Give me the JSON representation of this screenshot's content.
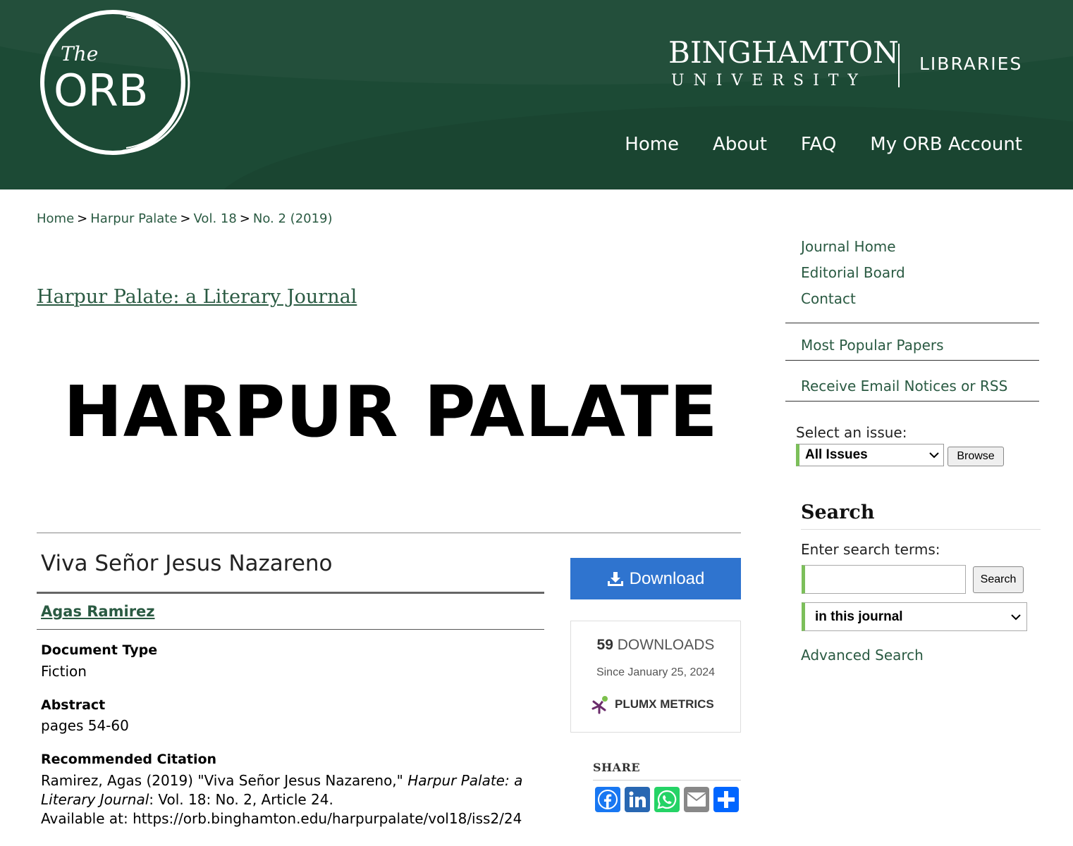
{
  "header": {
    "orb_logo_top": "The",
    "orb_logo_main": "ORB",
    "university_name": "BINGHAMTON",
    "university_sub": "UNIVERSITY",
    "libraries": "LIBRARIES",
    "nav": [
      "Home",
      "About",
      "FAQ",
      "My ORB Account"
    ],
    "background_color": "#1c4a35"
  },
  "breadcrumb": {
    "items": [
      "Home",
      "Harpur Palate",
      "Vol. 18",
      "No. 2 (2019)"
    ],
    "separator": ">"
  },
  "journal": {
    "title": "Harpur Palate: a Literary Journal",
    "banner": "HARPUR PALATE"
  },
  "article": {
    "title": "Viva Señor Jesus Nazareno",
    "author": "Agas Ramirez",
    "document_type_label": "Document Type",
    "document_type": "Fiction",
    "abstract_label": "Abstract",
    "abstract": "pages 54-60",
    "citation_label": "Recommended Citation",
    "citation_part1": "Ramirez, Agas (2019) \"Viva Señor Jesus Nazareno,\" ",
    "citation_journal": "Harpur Palate: a Literary Journal",
    "citation_part2": ": Vol. 18: No. 2, Article 24.",
    "citation_available": "Available at: https://orb.binghamton.edu/harpurpalate/vol18/iss2/24"
  },
  "download": {
    "label": "Download",
    "count": "59",
    "count_label": "DOWNLOADS",
    "since": "Since January 25, 2024",
    "plumx": "PLUMX METRICS",
    "button_color": "#2f74cf"
  },
  "share": {
    "label": "SHARE",
    "icons": [
      {
        "name": "facebook-icon",
        "color": "#1877f2"
      },
      {
        "name": "linkedin-icon",
        "color": "#2867b2"
      },
      {
        "name": "whatsapp-icon",
        "color": "#25d366"
      },
      {
        "name": "email-icon",
        "color": "#888888"
      },
      {
        "name": "share-icon",
        "color": "#0166ff"
      }
    ]
  },
  "sidebar": {
    "links": [
      "Journal Home",
      "Editorial Board",
      "Contact"
    ],
    "most_popular": "Most Popular Papers",
    "email_notices": "Receive Email Notices or RSS",
    "select_issue_label": "Select an issue:",
    "issue_selected": "All Issues",
    "browse_label": "Browse",
    "search_heading": "Search",
    "search_terms_label": "Enter search terms:",
    "search_value": "",
    "search_button": "Search",
    "scope_selected": "in this journal",
    "advanced_search": "Advanced Search",
    "accent_color": "#7cbf5a"
  }
}
